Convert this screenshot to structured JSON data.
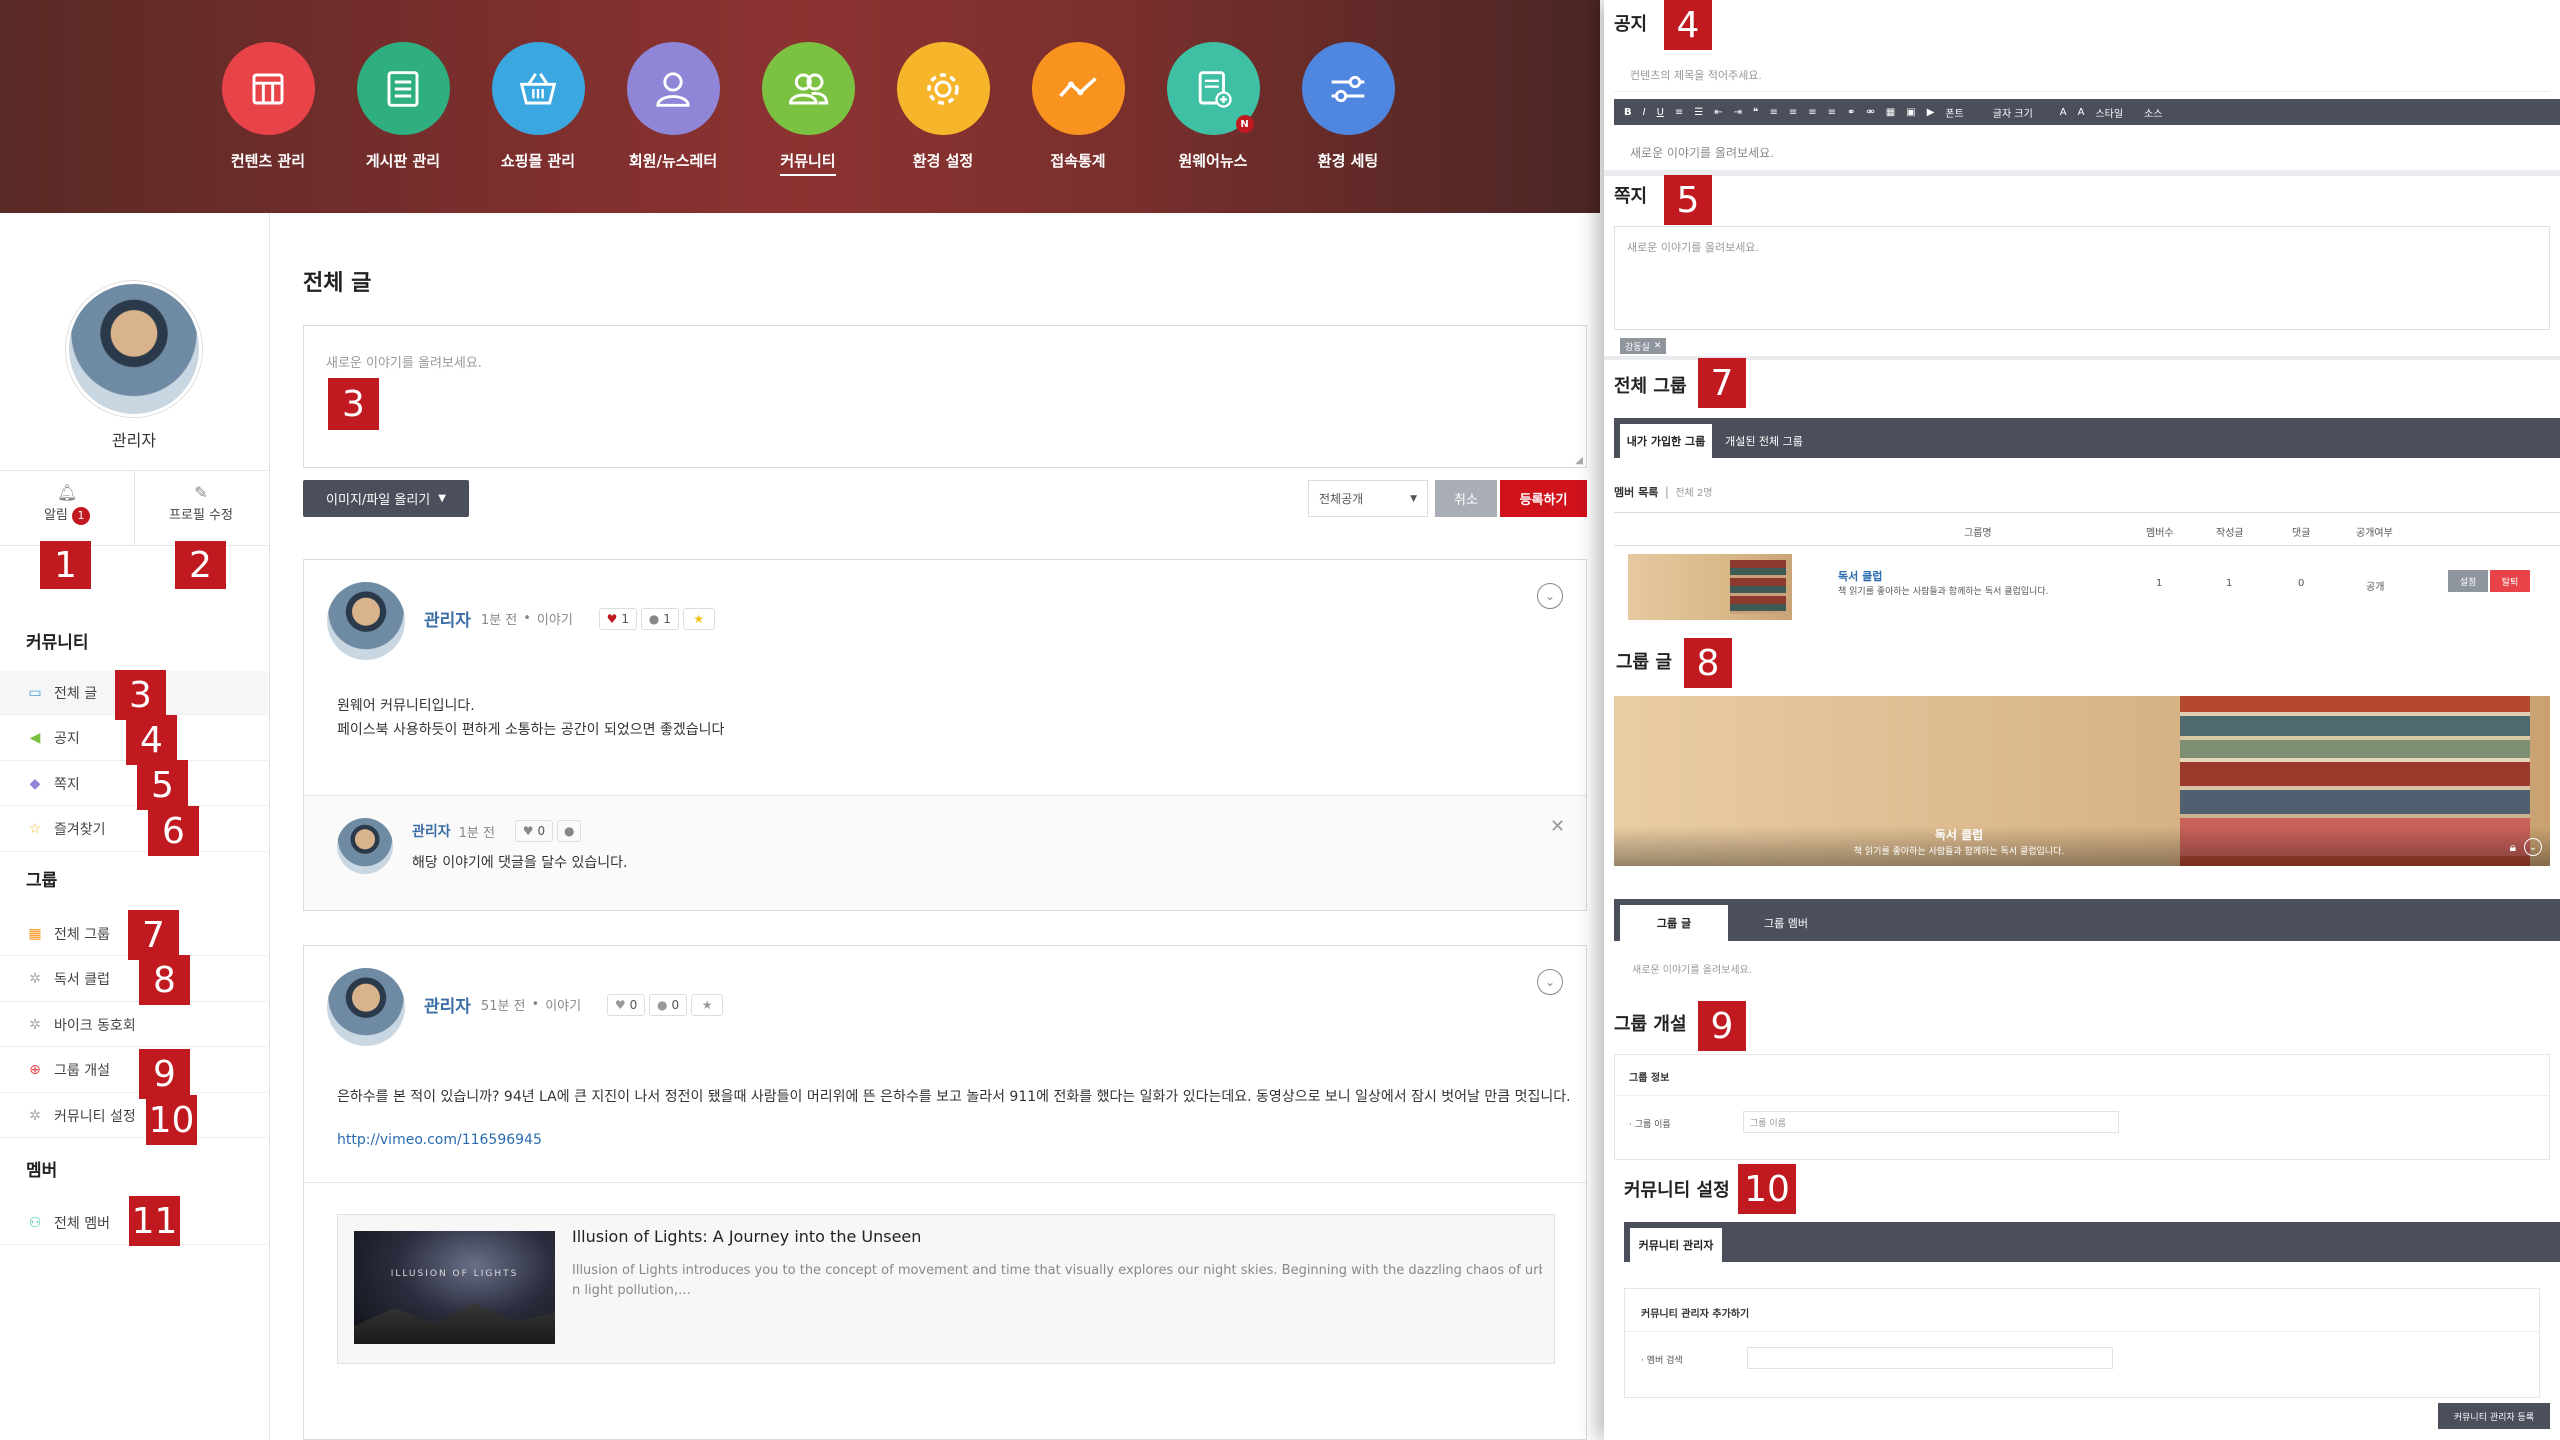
{
  "topnav": [
    {
      "label": "컨텐츠 관리",
      "color": "#e9434a",
      "icon": "layout-icon"
    },
    {
      "label": "게시판 관리",
      "color": "#2fae7f",
      "icon": "list-icon"
    },
    {
      "label": "쇼핑몰 관리",
      "color": "#3ba7e0",
      "icon": "basket-icon"
    },
    {
      "label": "회원/뉴스레터",
      "color": "#8f86d8",
      "icon": "person-icon"
    },
    {
      "label": "커뮤니티",
      "color": "#7cc242",
      "icon": "people-icon"
    },
    {
      "label": "환경 설정",
      "color": "#f6b52a",
      "icon": "gear-icon"
    },
    {
      "label": "접속통계",
      "color": "#f7931e",
      "icon": "line-chart-icon"
    },
    {
      "label": "원웨어뉴스",
      "color": "#3fbfa3",
      "icon": "news-icon",
      "badge": "N"
    },
    {
      "label": "환경 세팅",
      "color": "#4f86e0",
      "icon": "sliders-icon"
    }
  ],
  "sidebar": {
    "profile_name": "관리자",
    "alert_label": "알림",
    "alert_count": "1",
    "edit_profile_label": "프로필 수정",
    "community_head": "커뮤니티",
    "community_items": [
      {
        "label": "전체 글",
        "icon": "speech-icon",
        "color": "#4aa0d8"
      },
      {
        "label": "공지",
        "icon": "megaphone-icon",
        "color": "#7cc242"
      },
      {
        "label": "쪽지",
        "icon": "chat-icon",
        "color": "#8f86d8"
      },
      {
        "label": "즐겨찾기",
        "icon": "star-icon",
        "color": "#f6b52a"
      }
    ],
    "group_head": "그룹",
    "group_items": [
      {
        "label": "전체 그룹",
        "icon": "grid-icon",
        "color": "#f7931e"
      },
      {
        "label": "독서 클럽",
        "icon": "gear-small-icon",
        "color": "#aaa"
      },
      {
        "label": "바이크 동호회",
        "icon": "gear-small-icon",
        "color": "#aaa"
      },
      {
        "label": "그룹 개설",
        "icon": "plus-circle-icon",
        "color": "#e9434a"
      },
      {
        "label": "커뮤니티 설정",
        "icon": "gear-small-icon",
        "color": "#aaa"
      }
    ],
    "member_head": "멤버",
    "member_items": [
      {
        "label": "전체 멤버",
        "icon": "members-icon",
        "color": "#3fbfa3"
      }
    ]
  },
  "badges": {
    "b1": "1",
    "b2": "2",
    "b3": "3",
    "b4": "4",
    "b5": "5",
    "b6": "6",
    "b7": "7",
    "b8": "8",
    "b9": "9",
    "b10": "10",
    "b11": "11"
  },
  "main": {
    "title": "전체 글",
    "compose_placeholder": "새로운 이야기를 올려보세요.",
    "upload_button": "이미지/파일 올리기",
    "visibility": "전체공개",
    "cancel_button": "취소",
    "submit_button": "등록하기",
    "posts": [
      {
        "author": "관리자",
        "time": "1분 전",
        "category": "이야기",
        "likes": "1",
        "comments": "1",
        "line1": "원웨어 커뮤니티입니다.",
        "line2": "페이스북 사용하듯이 편하게 소통하는 공간이 되었으면 좋겠습니다",
        "reply_author": "관리자",
        "reply_time": "1분 전",
        "reply_likes": "0",
        "reply_text": "해당 이야기에 댓글을 달수 있습니다."
      },
      {
        "author": "관리자",
        "time": "51분 전",
        "category": "이야기",
        "likes": "0",
        "comments": "0",
        "body": "은하수를 본 적이 있습니까? 94년 LA에 큰 지진이 나서 정전이 됐을때 사람들이 머리위에 뜬 은하수를 보고 놀라서 911에 전화를 했다는 일화가 있다는데요. 동영상으로 보니 일상에서 잠시 벗어날 만큼 멋집니다.",
        "link": "http://vimeo.com/116596945",
        "embed_title": "Illusion of Lights: A Journey into the Unseen",
        "embed_desc1": "Illusion of Lights introduces you to the concept of movement and time that visually explores our night skies. Beginning with the dazzling chaos of urba",
        "embed_desc2": "n light pollution,…",
        "embed_thumb_text": "ILLUSION OF LIGHTS"
      }
    ]
  },
  "right": {
    "notice": {
      "title": "공지",
      "title_placeholder": "컨텐츠의 제목을 적어주세요.",
      "toolbar_font": "폰트",
      "toolbar_size": "글자 크기",
      "toolbar_style": "스타일",
      "toolbar_source": "소스",
      "body_placeholder": "새로운 이야기를 올려보세요."
    },
    "message": {
      "title": "쪽지",
      "placeholder": "새로운 이야기를 올려보세요.",
      "tag": "강동실"
    },
    "all_groups": {
      "title": "전체 그룹",
      "tab1": "내가 가입한 그룹",
      "tab2": "개설된 전체 그룹",
      "list_label": "멤버 목록",
      "list_count": "전체 2명",
      "headers": [
        "그룹명",
        "멤버수",
        "작성글",
        "댓글",
        "공개여부"
      ],
      "row": {
        "name": "독서 클럽",
        "desc": "책 읽기를 좋아하는 사람들과 함께하는 독서 클럽입니다.",
        "members": "1",
        "posts": "1",
        "comments": "0",
        "public": "공개",
        "btn1": "설정",
        "btn2": "탈퇴"
      }
    },
    "group_posts": {
      "title": "그룹 글",
      "banner_title": "독서 클럽",
      "banner_desc": "책 읽기를 좋아하는 사람들과 함께하는 독서 클럽입니다.",
      "tab1": "그룹 글",
      "tab2": "그룹 멤버",
      "placeholder": "새로운 이야기를 올려보세요."
    },
    "group_create": {
      "title": "그룹 개설",
      "section": "그룹 정보",
      "field_label": "그룹 이름",
      "field_placeholder": "그룹 이름"
    },
    "community_settings": {
      "title": "커뮤니티 설정",
      "tab": "커뮤니티 관리자",
      "section": "커뮤니티 관리자 추가하기",
      "field_label": "멤버 검색",
      "button": "커뮤니티 관리자 등록"
    }
  }
}
